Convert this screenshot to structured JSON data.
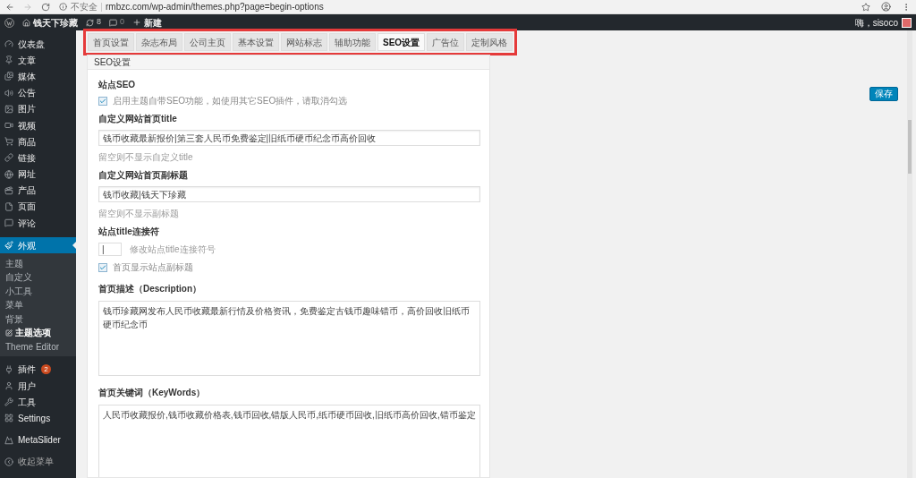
{
  "browser": {
    "security": "不安全",
    "url": "rmbzc.com/wp-admin/themes.php?page=begin-options"
  },
  "admin_bar": {
    "site": "钱天下珍藏",
    "updates": "8",
    "comments": "0",
    "new": "新建",
    "greeting": "嗨，sisoco"
  },
  "sidebar": {
    "items": [
      {
        "label": "仪表盘",
        "selected": false
      },
      {
        "label": "文章",
        "selected": false
      },
      {
        "label": "媒体",
        "selected": false
      },
      {
        "label": "公告",
        "selected": false
      },
      {
        "label": "图片",
        "selected": false
      },
      {
        "label": "视频",
        "selected": false
      },
      {
        "label": "商品",
        "selected": false
      },
      {
        "label": "链接",
        "selected": false
      },
      {
        "label": "网址",
        "selected": false
      },
      {
        "label": "产品",
        "selected": false
      },
      {
        "label": "页面",
        "selected": false
      },
      {
        "label": "评论",
        "selected": false
      },
      {
        "label": "外观",
        "selected": true,
        "children": [
          {
            "label": "主题",
            "selected": false
          },
          {
            "label": "自定义",
            "selected": false
          },
          {
            "label": "小工具",
            "selected": false
          },
          {
            "label": "菜单",
            "selected": false
          },
          {
            "label": "背景",
            "selected": false
          },
          {
            "label": "主题选项",
            "selected": true
          },
          {
            "label": "Theme Editor",
            "selected": false
          }
        ]
      },
      {
        "label": "插件",
        "selected": false,
        "badge": "2"
      },
      {
        "label": "用户",
        "selected": false
      },
      {
        "label": "工具",
        "selected": false
      },
      {
        "label": "Settings",
        "selected": false
      },
      {
        "label": "MetaSlider",
        "selected": false
      },
      {
        "label": "收起菜单",
        "selected": false
      }
    ]
  },
  "tabs": [
    {
      "label": "首页设置",
      "selected": false
    },
    {
      "label": "杂志布局",
      "selected": false
    },
    {
      "label": "公司主页",
      "selected": false
    },
    {
      "label": "基本设置",
      "selected": false
    },
    {
      "label": "网站标志",
      "selected": false
    },
    {
      "label": "辅助功能",
      "selected": false
    },
    {
      "label": "SEO设置",
      "selected": true
    },
    {
      "label": "广告位",
      "selected": false
    },
    {
      "label": "定制风格",
      "selected": false
    }
  ],
  "panel": {
    "title": "SEO设置",
    "section": "站点SEO",
    "fields": [
      {
        "kind": "checkbox",
        "label": "启用主题自带SEO功能，如使用其它SEO插件，请取消勾选",
        "checked": true
      },
      {
        "kind": "line",
        "label": "自定义网站首页title",
        "value": "钱币收藏最新报价|第三套人民币免费鉴定|旧纸币硬币纪念币高价回收",
        "hint": "留空则不显示自定义title"
      },
      {
        "kind": "line",
        "label": "自定义网站首页副标题",
        "value": "钱币收藏|钱天下珍藏",
        "hint": "留空则不显示副标题"
      },
      {
        "kind": "short",
        "label": "站点title连接符",
        "value": "|",
        "hint": "修改站点title连接符号"
      },
      {
        "kind": "checkbox",
        "label": "首页显示站点副标题",
        "checked": true
      },
      {
        "kind": "area",
        "label": "首页描述（Description）",
        "value": "钱币珍藏网发布人民币收藏最新行情及价格资讯，免费鉴定古钱币趣味错币，高价回收旧纸币硬币纪念币"
      },
      {
        "kind": "area",
        "label": "首页关键词（KeyWords）",
        "value": "人民币收藏报价,钱币收藏价格表,钱币回收,错版人民币,纸币硬币回收,旧纸币高价回收,错币鉴定"
      }
    ]
  },
  "save_button": "保存"
}
